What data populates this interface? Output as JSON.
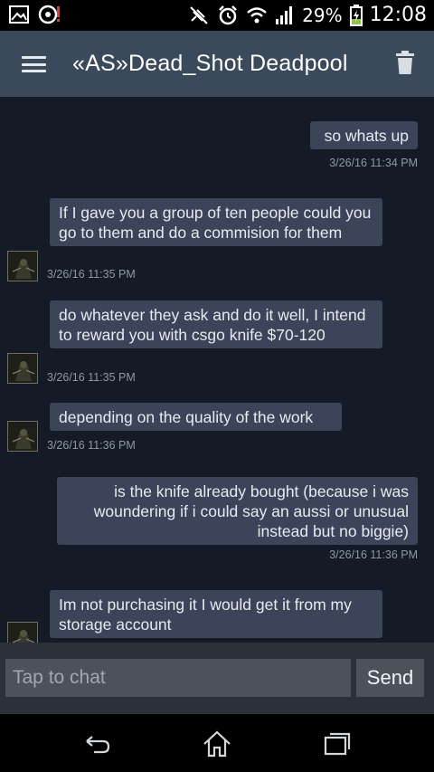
{
  "status_bar": {
    "battery": "29%",
    "time": "12:08",
    "icons": [
      "image-icon",
      "alert-icon",
      "mute-icon",
      "alarm-icon",
      "wifi-icon",
      "signal-icon",
      "battery-charging-icon"
    ]
  },
  "header": {
    "title": "«AS»Dead_Shot Deadpool",
    "menu_icon": "hamburger-icon",
    "delete_icon": "trash-icon"
  },
  "messages": [
    {
      "from": "me",
      "text": "so whats up",
      "time": "3/26/16 11:34 PM"
    },
    {
      "from": "them",
      "text": "If I gave you a group of ten people could you go to them and do a commision for them",
      "time": "3/26/16 11:35 PM"
    },
    {
      "from": "them",
      "text": "do whatever they ask and do it well, I intend to reward you with csgo knife $70-120",
      "time": "3/26/16 11:35 PM"
    },
    {
      "from": "them",
      "text": "depending on the quality of the work",
      "time": "3/26/16 11:36 PM"
    },
    {
      "from": "me",
      "text": "is the knife already bought (because i was woundering if i could say an aussi or unusual instead but no biggie)",
      "time": "3/26/16 11:36 PM"
    },
    {
      "from": "them",
      "text": "Im not purchasing it I would get it from my storage account",
      "time": ""
    }
  ],
  "composer": {
    "placeholder": "Tap to chat",
    "send_label": "Send"
  },
  "nav": {
    "back_icon": "back-icon",
    "home_icon": "home-icon",
    "recents_icon": "recents-icon"
  }
}
